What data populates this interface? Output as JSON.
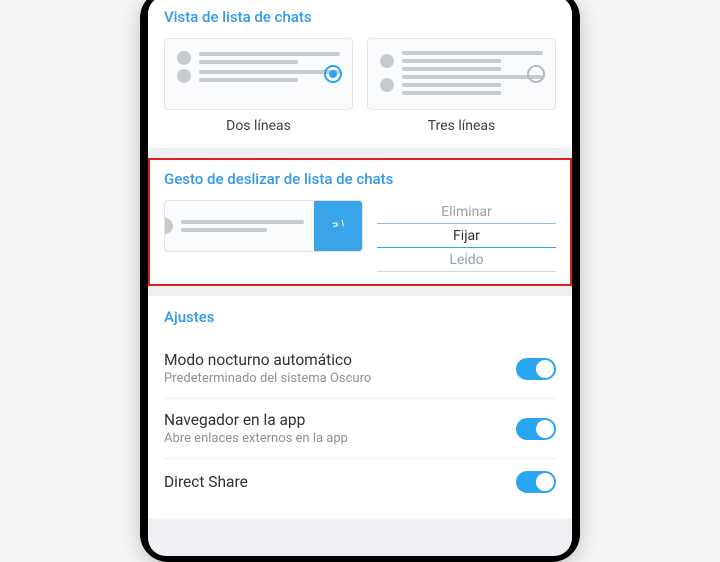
{
  "chatListView": {
    "title": "Vista de lista de chats",
    "option1Label": "Dos líneas",
    "option2Label": "Tres líneas",
    "selected": "Dos líneas"
  },
  "swipeGesture": {
    "title": "Gesto de deslizar de lista de chats",
    "options": {
      "delete": "Eliminar",
      "pin": "Fijar",
      "read": "Leído"
    },
    "selected": "Fijar"
  },
  "settings": {
    "title": "Ajustes",
    "nightMode": {
      "title": "Modo nocturno automático",
      "sub": "Predeterminado del sistema Oscuro",
      "on": true
    },
    "browser": {
      "title": "Navegador en la app",
      "sub": "Abre enlaces externos en la app",
      "on": true
    },
    "directShare": {
      "title": "Direct Share",
      "on": true
    }
  },
  "colors": {
    "accent": "#2aa5f0",
    "highlight": "#e02020"
  }
}
